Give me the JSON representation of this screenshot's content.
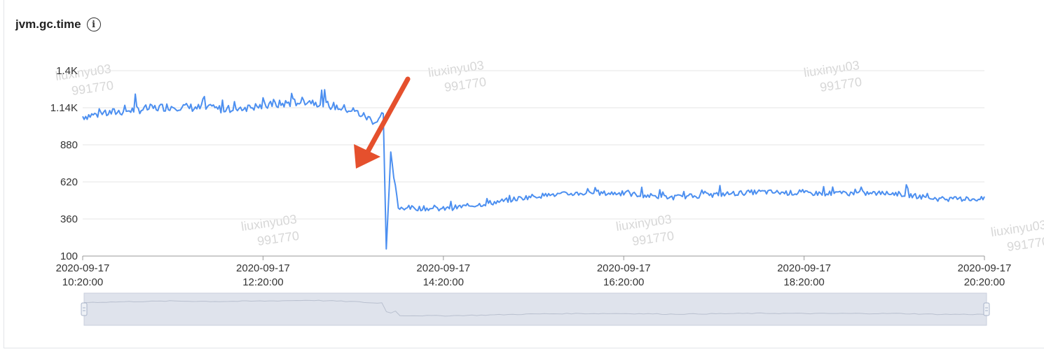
{
  "panel": {
    "title": "jvm.gc.time",
    "info_icon": "info-circle-icon",
    "info_glyph": "i"
  },
  "watermark": {
    "lines": [
      "liuxinyu03",
      "991770"
    ]
  },
  "colors": {
    "line": "#4c8ff0",
    "arrow": "#e5502d",
    "grid": "#e6e6e6",
    "axis": "#555555",
    "slider_bg": "#dfe3ec",
    "slider_handle": "#a8b3c9"
  },
  "chart_data": {
    "type": "line",
    "title": "jvm.gc.time",
    "xlabel": "",
    "ylabel": "",
    "ylim": [
      100,
      1400
    ],
    "y_ticks": [
      100,
      360,
      620,
      880,
      1140,
      1400
    ],
    "y_tick_labels": [
      "100",
      "360",
      "620",
      "880",
      "1.14K",
      "1.4K"
    ],
    "x_range": [
      "2020-09-17 10:20:00",
      "2020-09-17 20:20:00"
    ],
    "x_tick_labels": [
      [
        "2020-09-17",
        "10:20:00"
      ],
      [
        "2020-09-17",
        "12:20:00"
      ],
      [
        "2020-09-17",
        "14:20:00"
      ],
      [
        "2020-09-17",
        "16:20:00"
      ],
      [
        "2020-09-17",
        "18:20:00"
      ],
      [
        "2020-09-17",
        "20:20:00"
      ]
    ],
    "grid": true,
    "series": [
      {
        "values_note_hourly": "approximate readings at each hour",
        "x": [
          "10:20",
          "10:50",
          "11:20",
          "11:50",
          "12:20",
          "12:50",
          "13:20",
          "13:35",
          "13:40",
          "13:42",
          "13:45",
          "13:50",
          "14:20",
          "14:50",
          "15:20",
          "15:50",
          "16:20",
          "16:50",
          "17:20",
          "17:50",
          "18:20",
          "18:50",
          "19:20",
          "19:50",
          "20:20"
        ],
        "values": [
          1080,
          1120,
          1150,
          1130,
          1150,
          1190,
          1120,
          1040,
          1100,
          150,
          800,
          440,
          430,
          470,
          520,
          540,
          540,
          510,
          530,
          550,
          540,
          540,
          540,
          500,
          500
        ]
      }
    ],
    "annotation": "arrow pointing to drop at ~13:42"
  }
}
